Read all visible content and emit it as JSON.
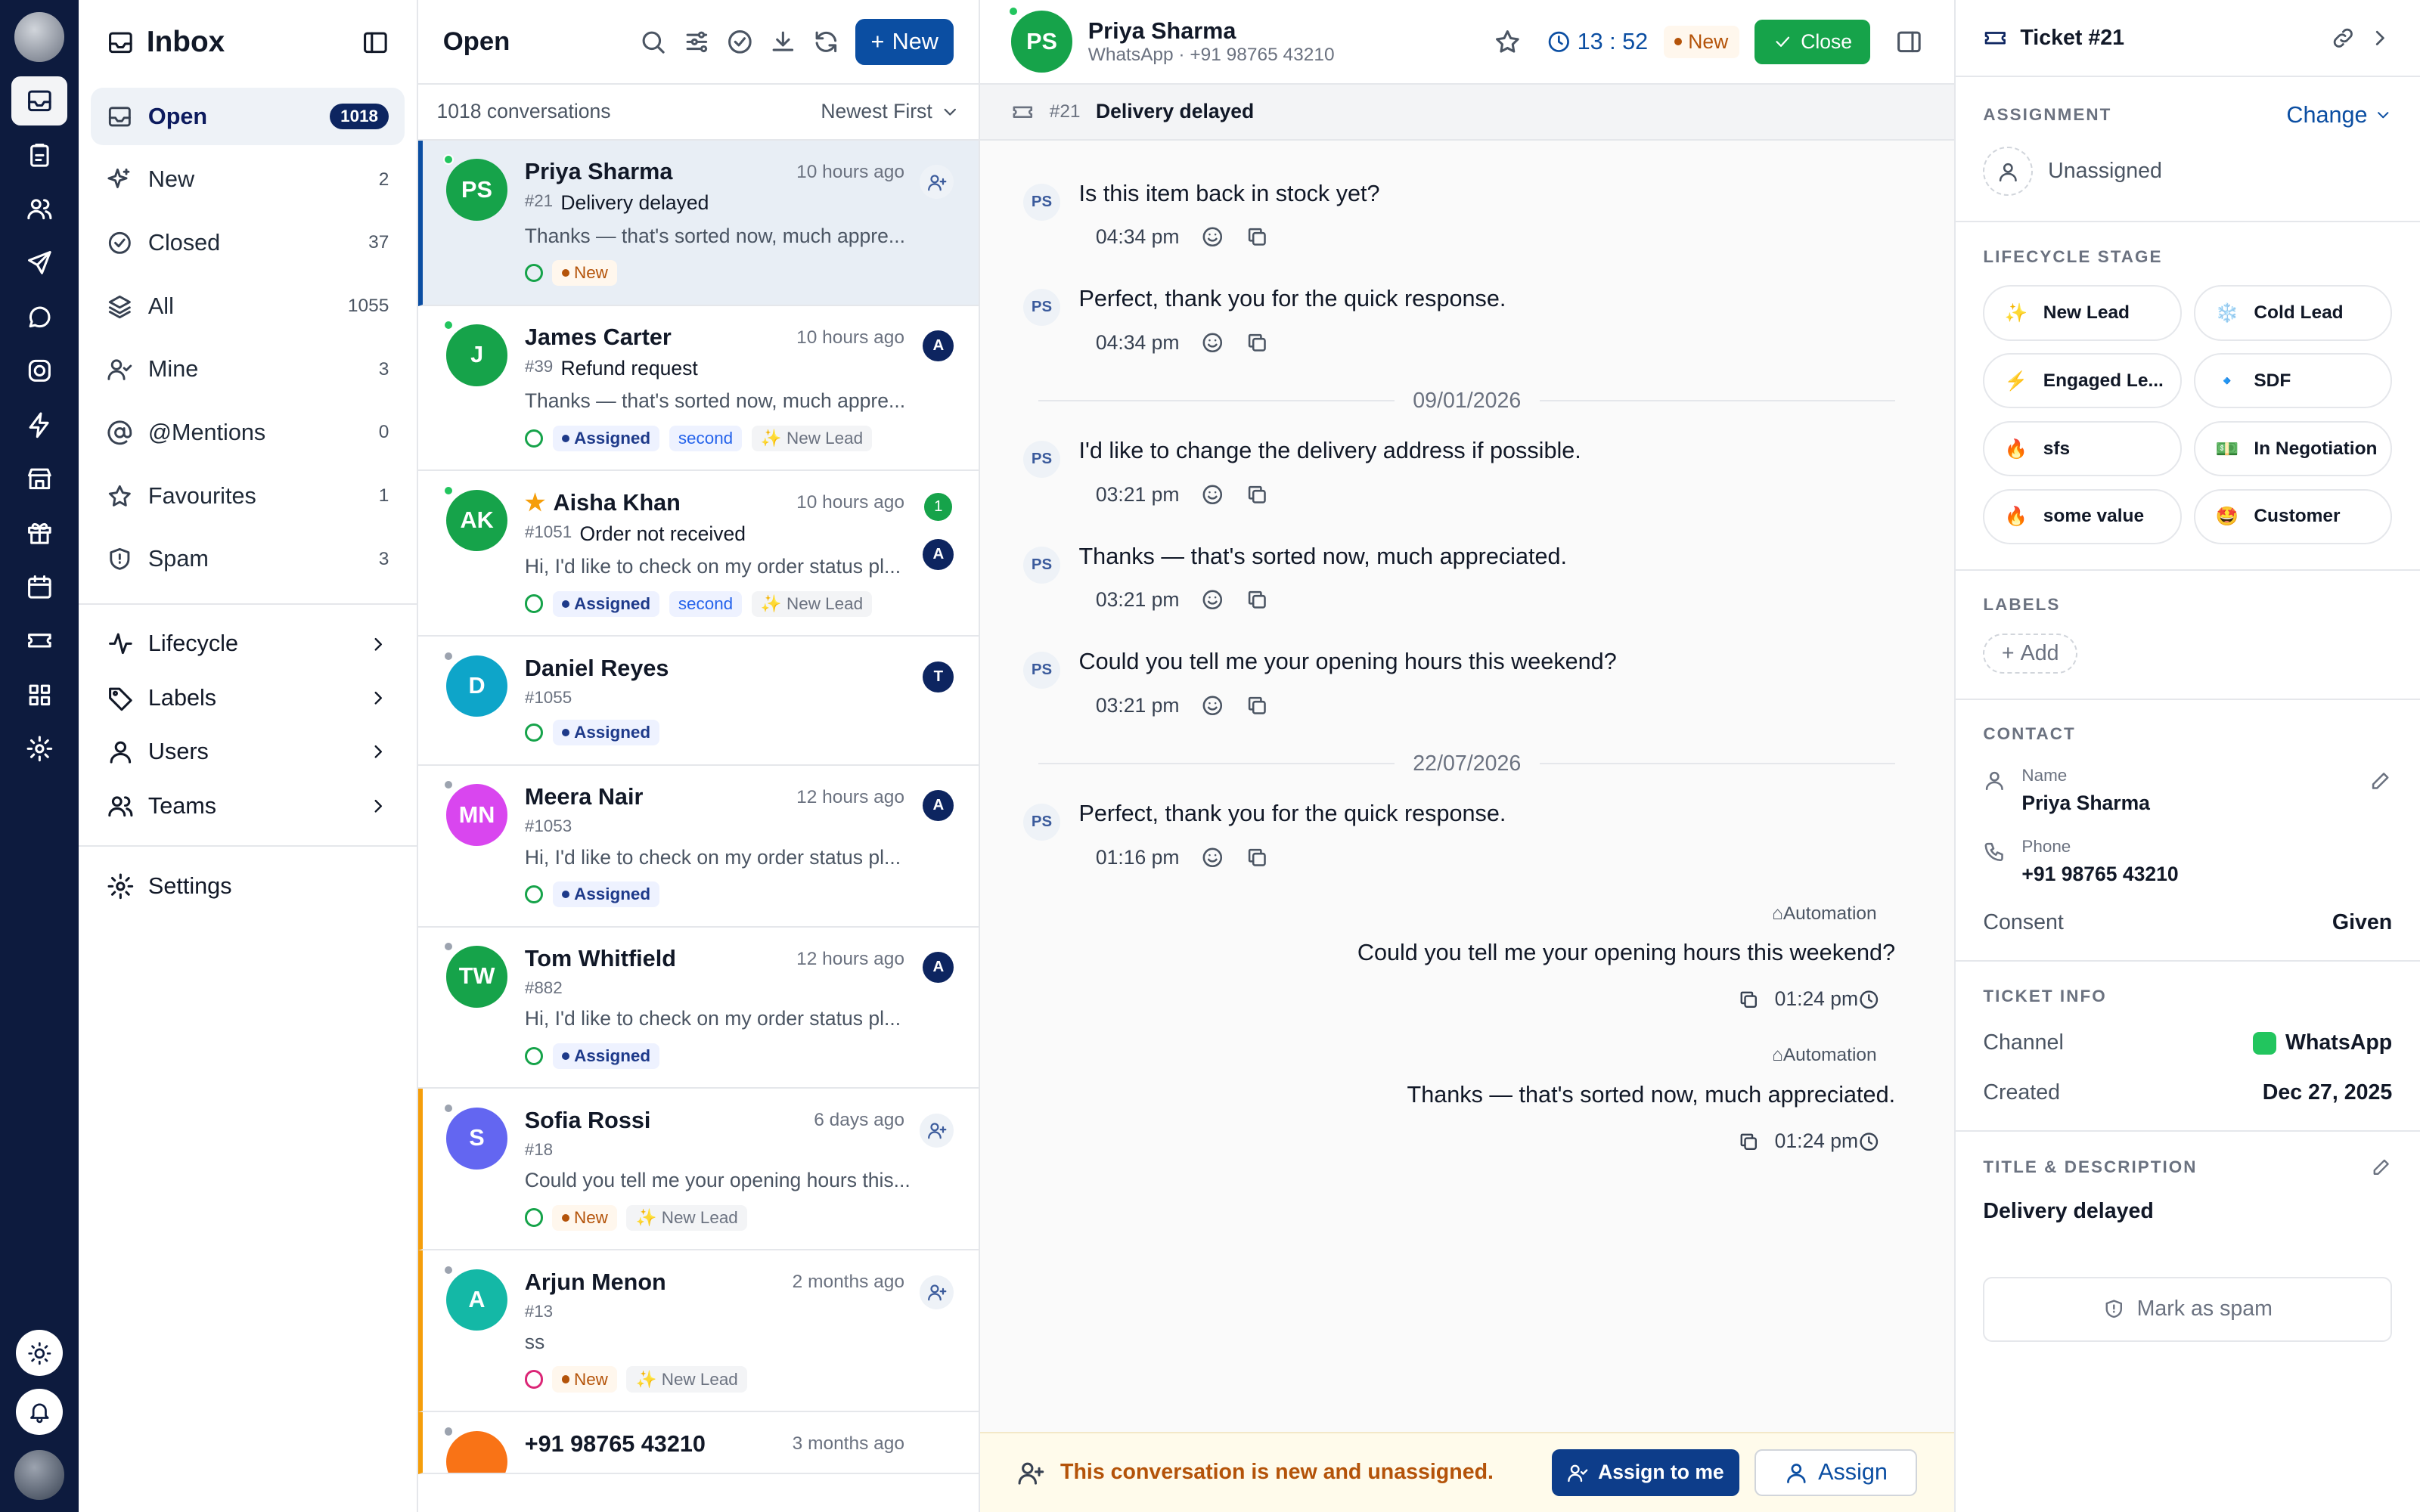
{
  "nav": {
    "title": "Inbox",
    "items": [
      {
        "label": "Open",
        "count": "1018"
      },
      {
        "label": "New",
        "count": "2"
      },
      {
        "label": "Closed",
        "count": "37"
      },
      {
        "label": "All",
        "count": "1055"
      },
      {
        "label": "Mine",
        "count": "3"
      },
      {
        "label": "@Mentions",
        "count": "0"
      },
      {
        "label": "Favourites",
        "count": "1"
      },
      {
        "label": "Spam",
        "count": "3"
      }
    ],
    "groups": [
      "Lifecycle",
      "Labels",
      "Users",
      "Teams"
    ],
    "settings": "Settings"
  },
  "list": {
    "title": "Open",
    "new_label": "New",
    "count_label": "1018 conversations",
    "sort_label": "Newest First",
    "items": [
      {
        "initials": "PS",
        "name": "Priya Sharma",
        "time": "10 hours ago",
        "id": "#21",
        "subject": "Delivery delayed",
        "preview": "Thanks — that's sorted now, much appre...",
        "tags": [
          "New"
        ]
      },
      {
        "initials": "J",
        "name": "James Carter",
        "time": "10 hours ago",
        "id": "#39",
        "subject": "Refund request",
        "preview": "Thanks — that's sorted now, much appre...",
        "tags": [
          "Assigned",
          "second",
          "✨ New Lead"
        ],
        "agent": "A"
      },
      {
        "initials": "AK",
        "name": "Aisha Khan",
        "time": "10 hours ago",
        "id": "#1051",
        "subject": "Order not received",
        "preview": "Hi, I'd like to check on my order status pl...",
        "tags": [
          "Assigned",
          "second",
          "✨ New Lead"
        ],
        "agent": "A",
        "unread": "1"
      },
      {
        "initials": "D",
        "name": "Daniel Reyes",
        "id": "#1055",
        "tags": [
          "Assigned"
        ],
        "agent": "T"
      },
      {
        "initials": "MN",
        "name": "Meera Nair",
        "time": "12 hours ago",
        "id": "#1053",
        "preview": "Hi, I'd like to check on my order status pl...",
        "tags": [
          "Assigned"
        ],
        "agent": "A"
      },
      {
        "initials": "TW",
        "name": "Tom Whitfield",
        "time": "12 hours ago",
        "id": "#882",
        "preview": "Hi, I'd like to check on my order status pl...",
        "tags": [
          "Assigned"
        ],
        "agent": "A"
      },
      {
        "initials": "S",
        "name": "Sofia Rossi",
        "time": "6 days ago",
        "id": "#18",
        "preview": "Could you tell me your opening hours this...",
        "tags": [
          "New",
          "✨ New Lead"
        ]
      },
      {
        "initials": "A",
        "name": "Arjun Menon",
        "time": "2 months ago",
        "id": "#13",
        "preview": "ss",
        "tags": [
          "New",
          "✨ New Lead"
        ]
      },
      {
        "name": "+91 98765 43210",
        "time": "3 months ago"
      }
    ]
  },
  "chat": {
    "initials": "PS",
    "name": "Priya Sharma",
    "sub": "WhatsApp · +91 98765 43210",
    "timer": "13 : 52",
    "status": "New",
    "close_label": "Close",
    "ticket_no": "#21",
    "ticket_title": "Delivery delayed",
    "messages": [
      {
        "text": "Is this item back in stock yet?",
        "time": "04:34 pm"
      },
      {
        "text": "Perfect, thank you for the quick response.",
        "time": "04:34 pm"
      },
      {
        "date": "09/01/2026"
      },
      {
        "text": "I'd like to change the delivery address if possible.",
        "time": "03:21 pm"
      },
      {
        "text": "Thanks — that's sorted now, much appreciated.",
        "time": "03:21 pm"
      },
      {
        "text": "Could you tell me your opening hours this weekend?",
        "time": "03:21 pm"
      },
      {
        "date": "22/07/2026"
      },
      {
        "text": "Perfect, thank you for the quick response.",
        "time": "01:16 pm"
      }
    ],
    "outgoing": [
      {
        "label": "Automation",
        "text": "Could you tell me your opening hours this weekend?",
        "time": "01:24 pm"
      },
      {
        "label": "Automation",
        "text": "Thanks — that's sorted now, much appreciated.",
        "time": "01:24 pm"
      }
    ],
    "banner_text": "This conversation is new and unassigned.",
    "assign_me": "Assign to me",
    "assign": "Assign"
  },
  "right": {
    "title": "Ticket #21",
    "assignment": "ASSIGNMENT",
    "change": "Change",
    "unassigned": "Unassigned",
    "lifecycle_title": "LIFECYCLE STAGE",
    "stages": [
      {
        "emoji": "✨",
        "label": "New Lead"
      },
      {
        "emoji": "❄️",
        "label": "Cold Lead"
      },
      {
        "emoji": "⚡",
        "label": "Engaged Le..."
      },
      {
        "emoji": "🔹",
        "label": "SDF"
      },
      {
        "emoji": "🔥",
        "label": "sfs"
      },
      {
        "emoji": "💵",
        "label": "In Negotiation"
      },
      {
        "emoji": "🔥",
        "label": "some value"
      },
      {
        "emoji": "🤩",
        "label": "Customer"
      }
    ],
    "labels_title": "LABELS",
    "add": "Add",
    "contact_title": "CONTACT",
    "name_label": "Name",
    "name_value": "Priya Sharma",
    "phone_label": "Phone",
    "phone_value": "+91 98765 43210",
    "consent_label": "Consent",
    "consent_value": "Given",
    "ticket_info": "TICKET INFO",
    "channel_label": "Channel",
    "channel_value": "WhatsApp",
    "created_label": "Created",
    "created_value": "Dec 27, 2025",
    "title_desc": "TITLE & DESCRIPTION",
    "desc_value": "Delivery delayed",
    "spam": "Mark as spam"
  },
  "colors": {
    "rail": "#0d1b3e",
    "accent": "#0b4ea2",
    "success": "#16a34a",
    "warning": "#b45309"
  }
}
